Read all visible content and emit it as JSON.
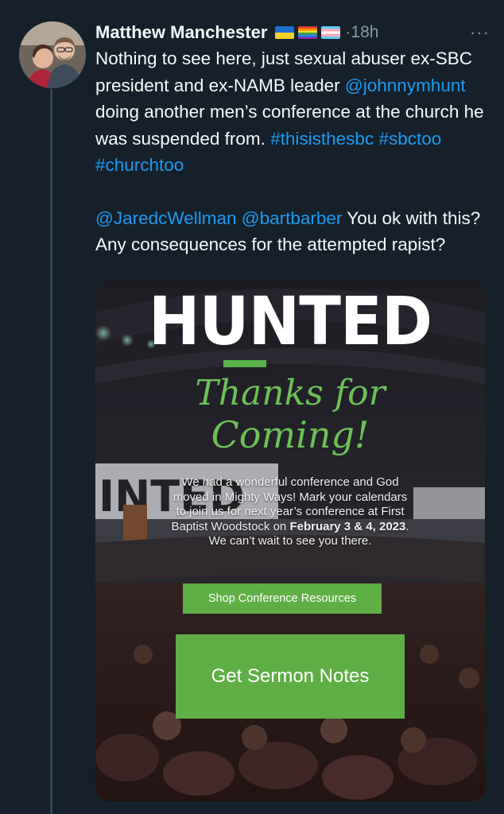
{
  "tweet": {
    "author_name": "Matthew Manchester",
    "flags": [
      "ukraine-flag-icon",
      "rainbow-flag-icon",
      "trans-flag-icon"
    ],
    "time": "·18h",
    "more": "···",
    "text": {
      "p1_a": "Nothing to see here, just sexual abuser ex-SBC president and ex-NAMB leader ",
      "mention_hunt": "@johnnymhunt",
      "p1_b": " doing another men’s conference at the church he was suspended from. ",
      "hashtags": "#thisisthesbc #sbctoo #churchtoo",
      "mention_wellman": "@JaredcWellman",
      "mention_barber": "@bartbarber",
      "p2_b": " You ok with this? Any consequences for the attempted rapist?"
    }
  },
  "media": {
    "headline": "HUNTED",
    "stage_sign": "INTED",
    "script_line1": "Thanks for",
    "script_line2": "Coming!",
    "message_a": "We had a wonderful conference and God moved in Mighty Ways! Mark your calendars to join us for next year’s conference at First Baptist Woodstock on ",
    "message_date": "February 3 & 4, 2023",
    "message_b": ". We can’t wait to see you there.",
    "shop_button": "Shop Conference Resources",
    "notes_button": "Get Sermon Notes",
    "accent_color": "#5fae46"
  },
  "colors": {
    "background": "#15202b",
    "link": "#1d9bf0",
    "muted": "#8b98a5"
  }
}
